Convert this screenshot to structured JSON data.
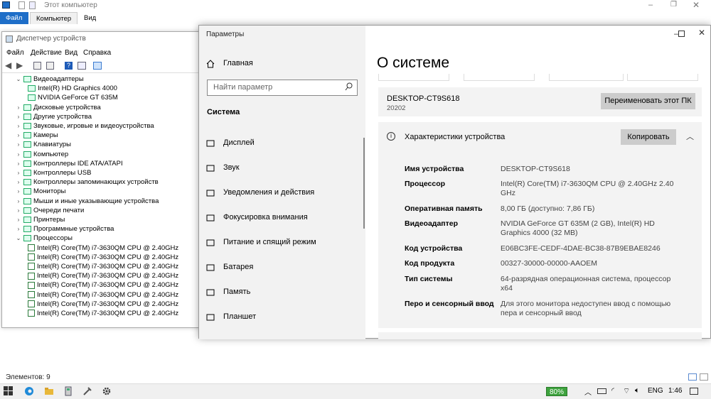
{
  "explorer": {
    "title": "Этот компьютер",
    "tabs": [
      "Файл",
      "Компьютер",
      "Вид"
    ],
    "status": "Элементов: 9"
  },
  "devmgr": {
    "title": "Диспетчер устройств",
    "menu": [
      "Файл",
      "Действие",
      "Вид",
      "Справка"
    ],
    "tree": [
      {
        "label": "Видеоадаптеры",
        "level": 0,
        "expanded": true
      },
      {
        "label": "Intel(R) HD Graphics 4000",
        "level": 1
      },
      {
        "label": "NVIDIA GeForce GT 635M",
        "level": 1
      },
      {
        "label": "Дисковые устройства",
        "level": 0
      },
      {
        "label": "Другие устройства",
        "level": 0
      },
      {
        "label": "Звуковые, игровые и видеоустройства",
        "level": 0
      },
      {
        "label": "Камеры",
        "level": 0
      },
      {
        "label": "Клавиатуры",
        "level": 0
      },
      {
        "label": "Компьютер",
        "level": 0
      },
      {
        "label": "Контроллеры IDE ATA/ATAPI",
        "level": 0
      },
      {
        "label": "Контроллеры USB",
        "level": 0
      },
      {
        "label": "Контроллеры запоминающих устройств",
        "level": 0
      },
      {
        "label": "Мониторы",
        "level": 0
      },
      {
        "label": "Мыши и иные указывающие устройства",
        "level": 0
      },
      {
        "label": "Очереди печати",
        "level": 0
      },
      {
        "label": "Принтеры",
        "level": 0
      },
      {
        "label": "Программные устройства",
        "level": 0
      },
      {
        "label": "Процессоры",
        "level": 0,
        "expanded": true
      },
      {
        "label": "Intel(R) Core(TM) i7-3630QM CPU @ 2.40GHz",
        "level": 1,
        "cpu": true
      },
      {
        "label": "Intel(R) Core(TM) i7-3630QM CPU @ 2.40GHz",
        "level": 1,
        "cpu": true
      },
      {
        "label": "Intel(R) Core(TM) i7-3630QM CPU @ 2.40GHz",
        "level": 1,
        "cpu": true
      },
      {
        "label": "Intel(R) Core(TM) i7-3630QM CPU @ 2.40GHz",
        "level": 1,
        "cpu": true
      },
      {
        "label": "Intel(R) Core(TM) i7-3630QM CPU @ 2.40GHz",
        "level": 1,
        "cpu": true
      },
      {
        "label": "Intel(R) Core(TM) i7-3630QM CPU @ 2.40GHz",
        "level": 1,
        "cpu": true
      },
      {
        "label": "Intel(R) Core(TM) i7-3630QM CPU @ 2.40GHz",
        "level": 1,
        "cpu": true
      },
      {
        "label": "Intel(R) Core(TM) i7-3630QM CPU @ 2.40GHz",
        "level": 1,
        "cpu": true
      }
    ]
  },
  "settings": {
    "window_title": "Параметры",
    "home": "Главная",
    "search_placeholder": "Найти параметр",
    "section": "Система",
    "nav": [
      {
        "label": "Дисплей",
        "icon": "display-icon"
      },
      {
        "label": "Звук",
        "icon": "sound-icon"
      },
      {
        "label": "Уведомления и действия",
        "icon": "notifications-icon"
      },
      {
        "label": "Фокусировка внимания",
        "icon": "focus-icon"
      },
      {
        "label": "Питание и спящий режим",
        "icon": "power-icon"
      },
      {
        "label": "Батарея",
        "icon": "battery-icon"
      },
      {
        "label": "Память",
        "icon": "storage-icon"
      },
      {
        "label": "Планшет",
        "icon": "tablet-icon"
      }
    ],
    "page_title": "О системе",
    "pc_name": "DESKTOP-CT9S618",
    "pc_sub": "20202",
    "rename_button": "Переименовать этот ПК",
    "specs_title": "Характеристики устройства",
    "copy_button": "Копировать",
    "specs": [
      {
        "key": "Имя устройства",
        "value": "DESKTOP-CT9S618"
      },
      {
        "key": "Процессор",
        "value": "Intel(R) Core(TM) i7-3630QM CPU @ 2.40GHz   2.40 GHz"
      },
      {
        "key": "Оперативная память",
        "value": "8,00 ГБ (доступно: 7,86 ГБ)"
      },
      {
        "key": "Видеоадаптер",
        "value": "NVIDIA GeForce GT 635M (2 GB), Intel(R) HD Graphics 4000 (32 MB)"
      },
      {
        "key": "Код устройства",
        "value": "E06BC3FE-CEDF-4DAE-BC38-87B9EBAE8246"
      },
      {
        "key": "Код продукта",
        "value": "00327-30000-00000-AAOEM"
      },
      {
        "key": "Тип системы",
        "value": "64-разрядная операционная система, процессор x64"
      },
      {
        "key": "Перо и сенсорный ввод",
        "value": "Для этого монитора недоступен ввод с помощью пера и сенсорный ввод"
      }
    ]
  },
  "taskbar": {
    "battery": "80%",
    "lang": "ENG",
    "time": "1:46"
  }
}
